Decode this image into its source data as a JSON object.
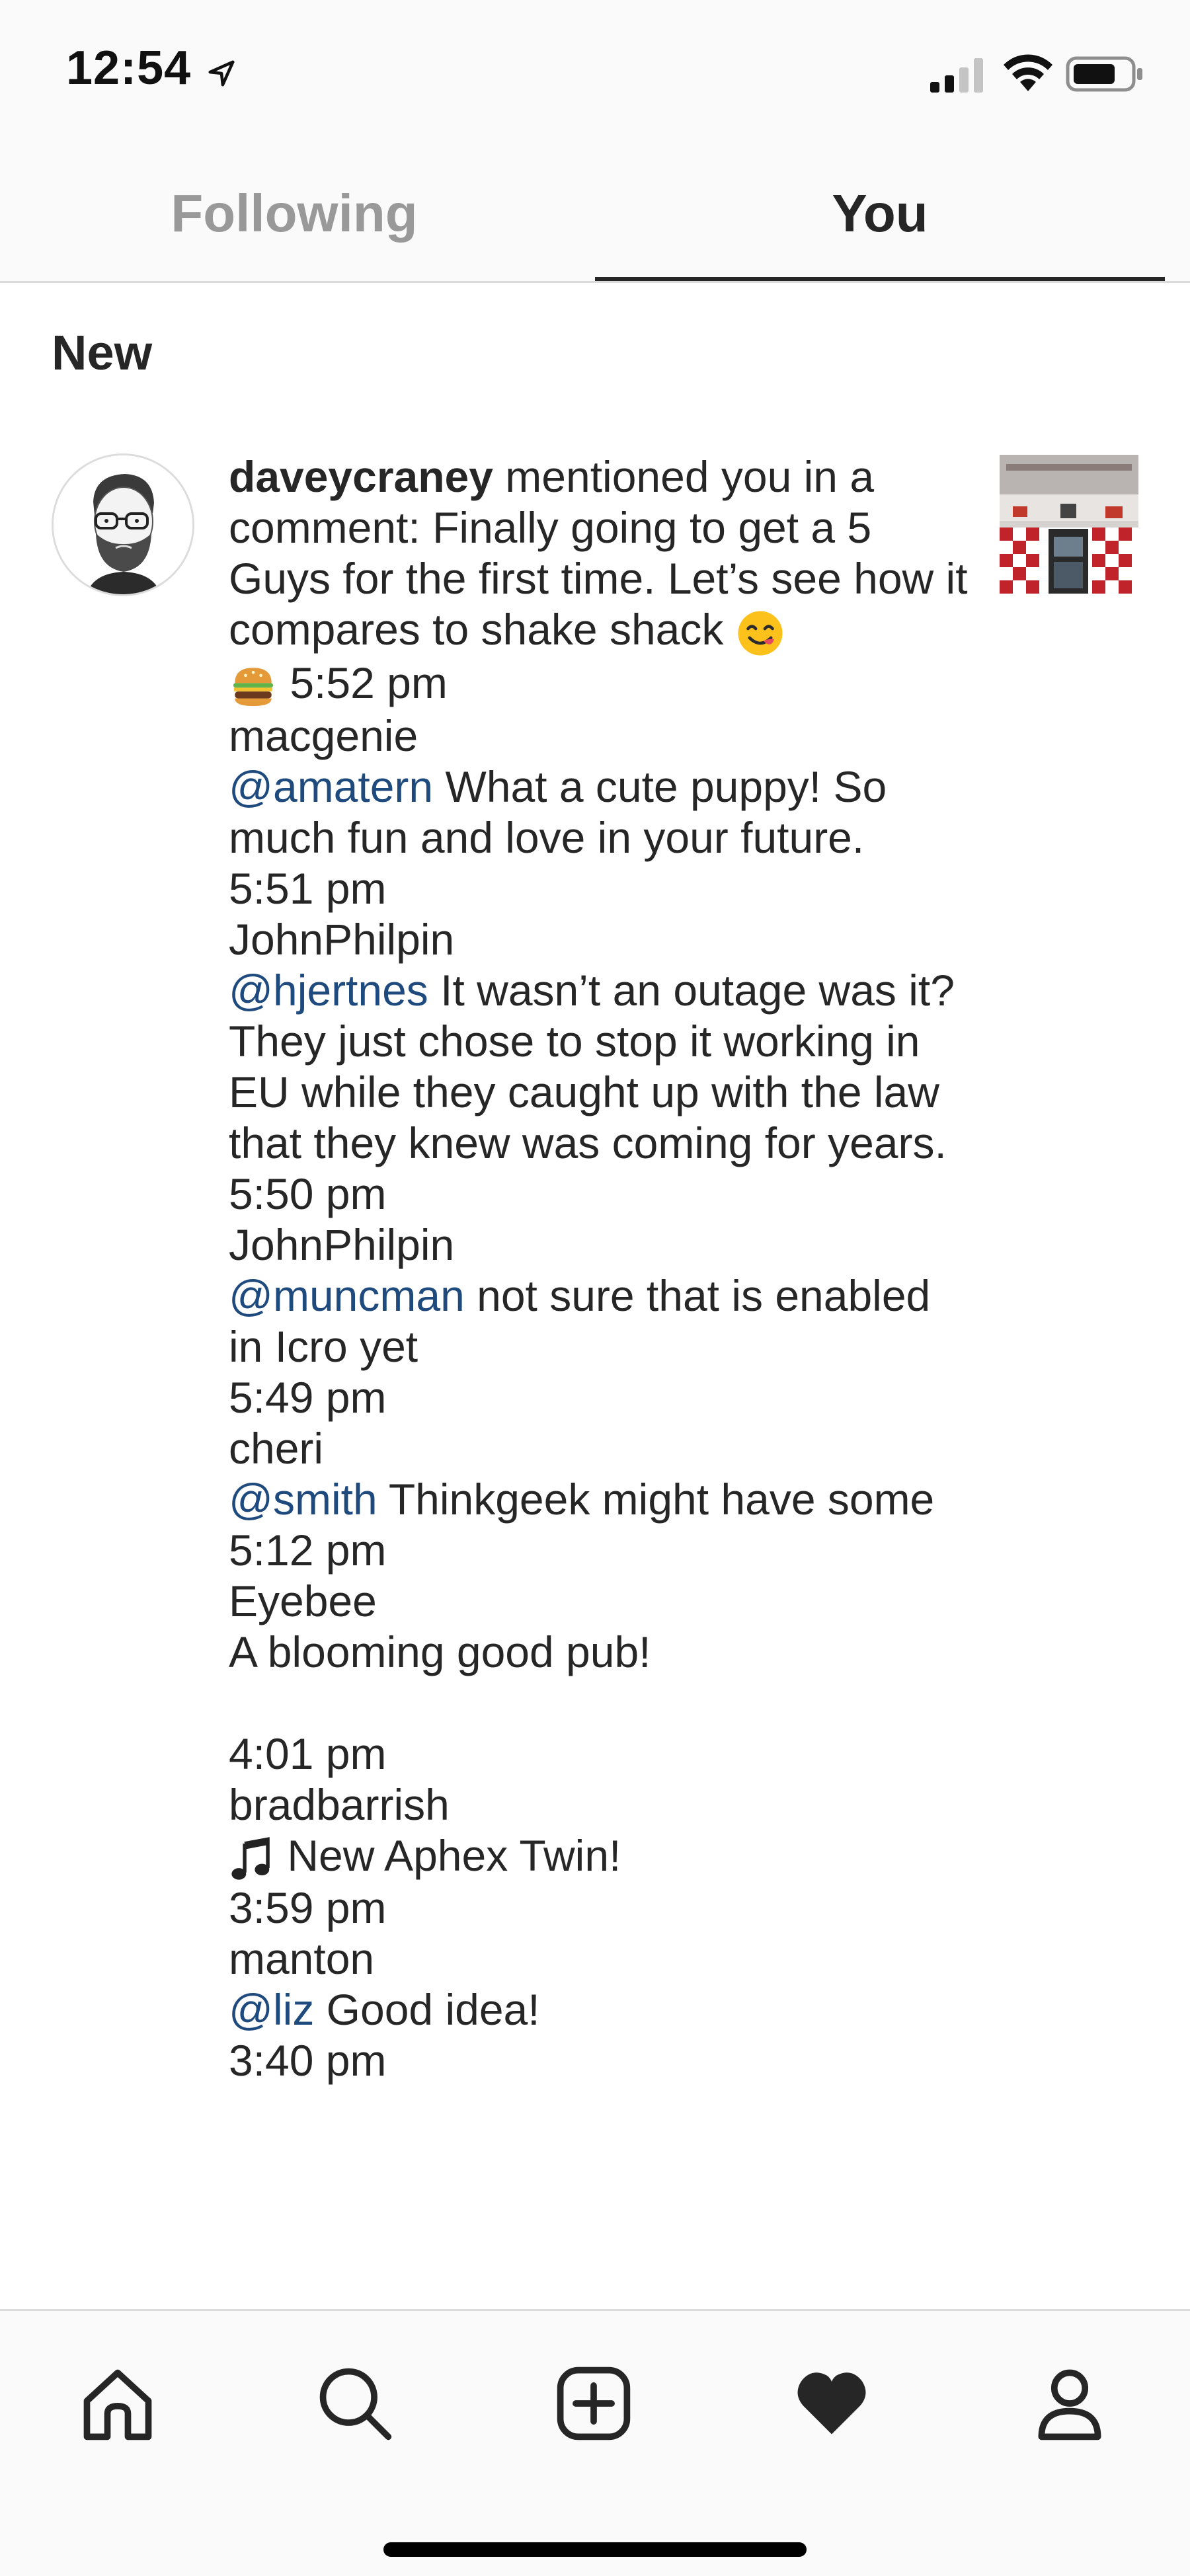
{
  "status_bar": {
    "time": "12:54"
  },
  "tabs": [
    {
      "label": "Following",
      "active": false
    },
    {
      "label": "You",
      "active": true
    }
  ],
  "section": {
    "label": "New"
  },
  "notification": {
    "username": "daveycraney",
    "action": " mentioned you in a comment: Finally going to get a 5 Guys for the first time. Let’s see how it compares to shake shack",
    "time": "5:52 pm"
  },
  "feed": [
    {
      "user": "macgenie",
      "mention": "@amatern",
      "text": " What a cute puppy! So much fun and love in your future.",
      "time": "5:51 pm"
    },
    {
      "user": "JohnPhilpin",
      "mention": "@hjertnes",
      "text": " It wasn’t an outage was it? They just chose to stop it working in EU while they caught up with the law that they knew was coming for years.",
      "time": "5:50 pm"
    },
    {
      "user": "JohnPhilpin",
      "mention": "@muncman",
      "text": " not sure that is enabled in Icro yet",
      "time": "5:49 pm"
    },
    {
      "user": "cheri",
      "mention": "@smith",
      "text": " Thinkgeek might have some",
      "time": "5:12 pm"
    },
    {
      "user": "Eyebee",
      "mention": "",
      "text": "A blooming good pub!",
      "time": "4:01 pm"
    },
    {
      "user": "bradbarrish",
      "mention": "",
      "text": " New Aphex Twin!",
      "time": "3:59 pm"
    },
    {
      "user": "manton",
      "mention": "@liz",
      "text": " Good idea!",
      "time": "3:40 pm"
    }
  ],
  "colors": {
    "mention": "#1e4a7e",
    "text": "#262626",
    "tab_inactive": "#999999",
    "background": "#ffffff",
    "bar_background": "#fafafa"
  },
  "icons": {
    "emoji_face": "face-savoring-food-icon",
    "emoji_burger": "hamburger-icon",
    "music_note": "music-note-icon"
  },
  "bottom_nav": [
    {
      "icon": "home-icon"
    },
    {
      "icon": "search-icon"
    },
    {
      "icon": "add-post-icon"
    },
    {
      "icon": "heart-icon",
      "active": true
    },
    {
      "icon": "profile-icon"
    }
  ]
}
